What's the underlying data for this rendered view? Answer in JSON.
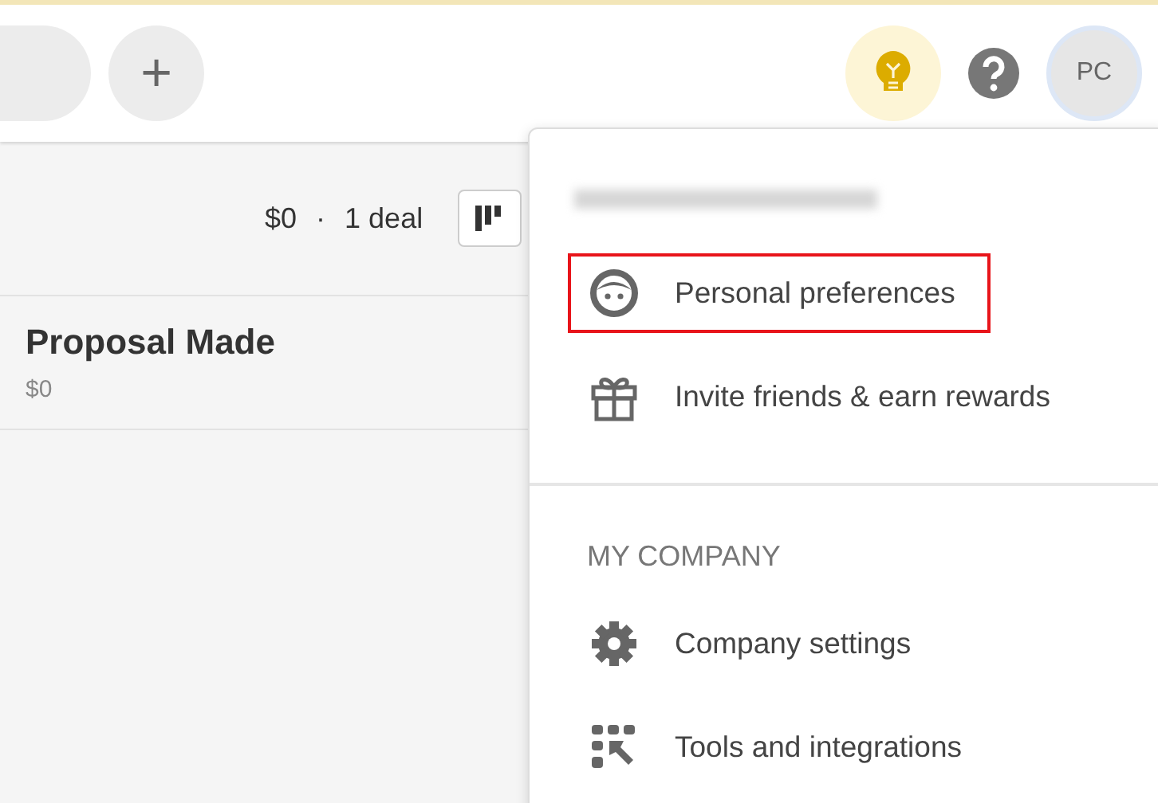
{
  "topbar": {
    "add_button": "+",
    "avatar": "PC"
  },
  "summary": {
    "amount": "$0",
    "separator": "·",
    "count": "1 deal"
  },
  "stage": {
    "title": "Proposal Made",
    "amount": "$0"
  },
  "menu": {
    "sections": [
      {
        "items": [
          {
            "kind": "face",
            "label": "Personal preferences",
            "highlighted": true
          },
          {
            "kind": "gift",
            "label": "Invite friends & earn rewards",
            "highlighted": false
          }
        ]
      },
      {
        "heading": "MY COMPANY",
        "items": [
          {
            "kind": "gear",
            "label": "Company settings",
            "highlighted": false
          },
          {
            "kind": "tools",
            "label": "Tools and integrations",
            "highlighted": false
          }
        ]
      }
    ]
  }
}
